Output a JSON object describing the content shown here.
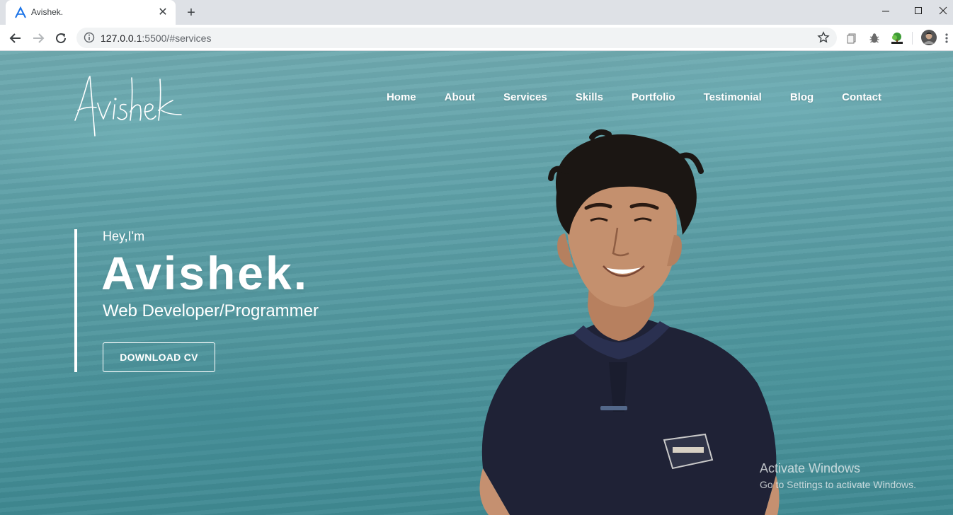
{
  "browser": {
    "tab": {
      "title": "Avishek.",
      "favicon": "letter-a-icon"
    },
    "url": {
      "host": "127.0.0.1",
      "rest": ":5500/#services"
    },
    "icons": {
      "back": "arrow-left-icon",
      "forward": "arrow-right-icon",
      "reload": "reload-icon",
      "info": "info-icon",
      "bookmark": "star-icon",
      "new_tab": "plus-icon",
      "minimize": "minimize-icon",
      "maximize": "maximize-icon",
      "close": "close-icon"
    },
    "extensions": [
      "copy-extension-icon",
      "bug-extension-icon",
      "tree-extension-icon",
      "profile-avatar"
    ]
  },
  "site": {
    "nav": [
      "Home",
      "About",
      "Services",
      "Skills",
      "Portfolio",
      "Testimonial",
      "Blog",
      "Contact"
    ],
    "hero": {
      "greeting": "Hey,I'm",
      "name": "Avishek.",
      "role": "Web Developer/Programmer",
      "cta": "DOWNLOAD CV"
    }
  },
  "os_watermark": {
    "title": "Activate Windows",
    "subtitle": "Go to Settings to activate Windows."
  },
  "colors": {
    "hero_text": "#ffffff",
    "sea_top": "#6faab0",
    "sea_bottom": "#3f8992",
    "shirt": "#1f2236"
  }
}
